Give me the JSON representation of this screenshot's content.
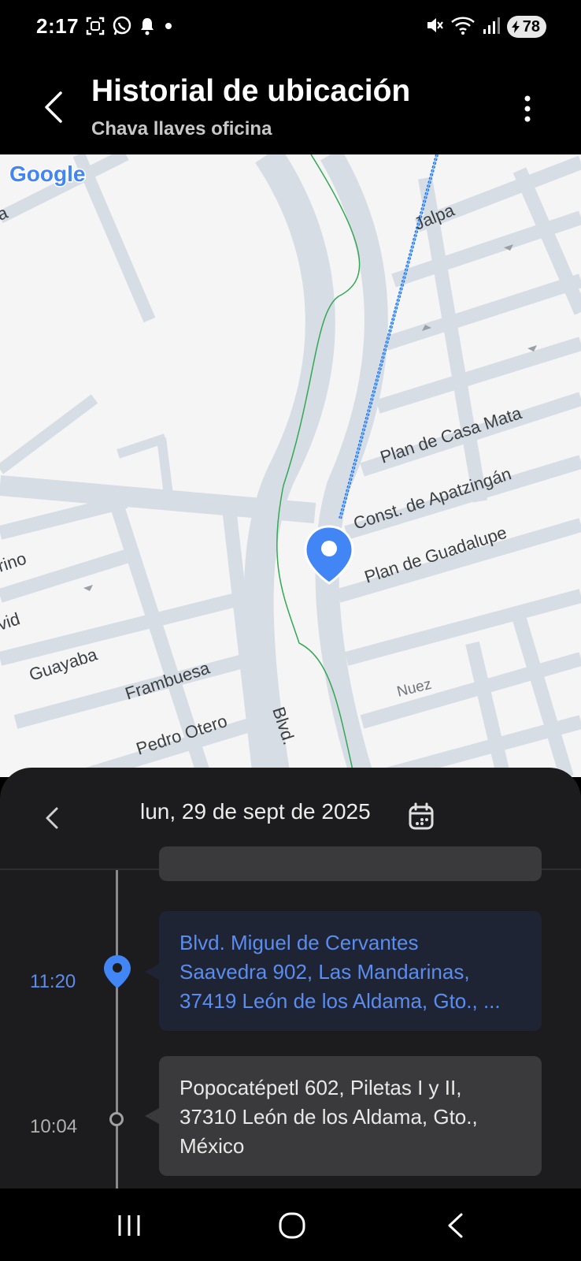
{
  "status_bar": {
    "time": "2:17",
    "left_icons": [
      "screenshot-icon",
      "whatsapp-icon",
      "bell-icon",
      "dot-icon"
    ],
    "right_icons": [
      "mute-icon",
      "wifi-icon",
      "signal-icon"
    ],
    "battery": "78"
  },
  "app_bar": {
    "title": "Historial de ubicación",
    "subtitle": "Chava llaves oficina"
  },
  "map": {
    "logo": "Google",
    "streets": [
      "Jalpa",
      "Plan de Casa Mata",
      "Const. de Apatzingán",
      "Plan de Guadalupe",
      "rino",
      "vid",
      "Guayaba",
      "Frambuesa",
      "Pedro Otero",
      "Blvd.",
      "Nuez",
      "a"
    ],
    "colors": {
      "route": "#1a73e8",
      "pin": "#4285f4",
      "road": "#d6dde5",
      "background": "#f5f5f5",
      "path": "#34a853"
    }
  },
  "sheet": {
    "date": "lun, 29 de sept de 2025",
    "entries": [
      {
        "time": "11:20",
        "lines": [
          "Blvd. Miguel de Cervantes",
          "Saavedra 902, Las Mandarinas,",
          "37419 León de los Aldama, Gto., ..."
        ],
        "active": true
      },
      {
        "time": "10:04",
        "lines": [
          "Popocatépetl 602, Piletas I y II,",
          "37310 León de los Aldama, Gto.,",
          "México"
        ],
        "active": false
      }
    ]
  },
  "nav_bar": {
    "buttons": [
      "recents-icon",
      "home-icon",
      "back-icon"
    ]
  }
}
